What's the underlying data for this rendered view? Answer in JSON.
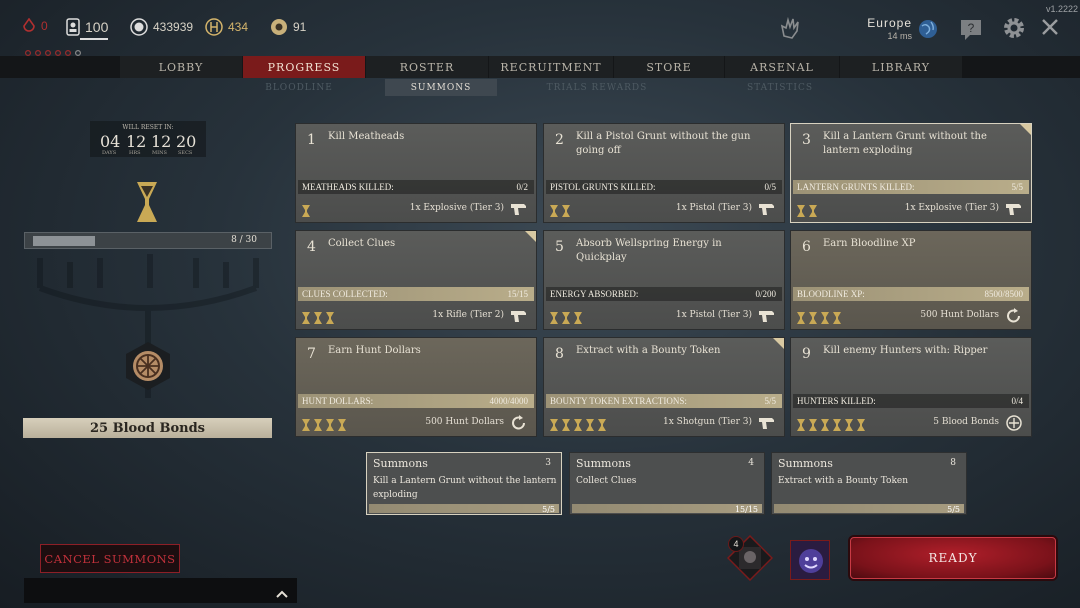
{
  "version": "v1.2222",
  "topbar": {
    "blood_value": "0",
    "hunters_value": "100",
    "hunt_dollars": "433939",
    "bloodline_value": "434",
    "event_points": "91",
    "region": "Europe",
    "ping": "14 ms"
  },
  "nav": {
    "tabs": [
      "LOBBY",
      "PROGRESS",
      "ROSTER",
      "RECRUITMENT",
      "STORE",
      "ARSENAL",
      "LIBRARY"
    ],
    "active": "PROGRESS"
  },
  "subnav": {
    "tabs": [
      "BLOODLINE",
      "SUMMONS",
      "TRIALS REWARDS",
      "STATISTICS"
    ],
    "active": "SUMMONS"
  },
  "reset": {
    "label": "WILL RESET IN:",
    "days": "04",
    "hrs": "12",
    "mins": "12",
    "secs": "20",
    "days_l": "DAYS",
    "hrs_l": "HRS",
    "mins_l": "MINS",
    "secs_l": "SECS"
  },
  "left": {
    "progress_text": "8 / 30",
    "progress_fraction": 0.27,
    "bonds_label": "25 Blood Bonds"
  },
  "cards": [
    {
      "num": "1",
      "title": "Kill Meatheads",
      "bar_label": "MEATHEADS KILLED:",
      "count": "0/2",
      "fraction": 0,
      "reward": "1x Explosive (Tier 3)",
      "icon": "revolver-icon",
      "tier": 1,
      "tan": false,
      "selected": false,
      "star": false
    },
    {
      "num": "2",
      "title": "Kill a Pistol Grunt without the gun going off",
      "bar_label": "PISTOL GRUNTS KILLED:",
      "count": "0/5",
      "fraction": 0,
      "reward": "1x Pistol (Tier 3)",
      "icon": "revolver-icon",
      "tier": 2,
      "tan": false,
      "selected": false,
      "star": false
    },
    {
      "num": "3",
      "title": "Kill a Lantern Grunt without the lantern exploding",
      "bar_label": "LANTERN GRUNTS KILLED:",
      "count": "5/5",
      "fraction": 1,
      "reward": "1x Explosive (Tier 3)",
      "icon": "revolver-icon",
      "tier": 2,
      "tan": false,
      "selected": true,
      "star": true
    },
    {
      "num": "4",
      "title": "Collect Clues",
      "bar_label": "CLUES COLLECTED:",
      "count": "15/15",
      "fraction": 1,
      "reward": "1x Rifle (Tier 2)",
      "icon": "revolver-icon",
      "tier": 3,
      "tan": false,
      "selected": false,
      "star": true
    },
    {
      "num": "5",
      "title": "Absorb Wellspring Energy in Quickplay",
      "bar_label": "ENERGY ABSORBED:",
      "count": "0/200",
      "fraction": 0,
      "reward": "1x Pistol (Tier 3)",
      "icon": "revolver-icon",
      "tier": 3,
      "tan": false,
      "selected": false,
      "star": false
    },
    {
      "num": "6",
      "title": "Earn Bloodline XP",
      "bar_label": "BLOODLINE XP:",
      "count": "8500/8500",
      "fraction": 1,
      "reward": "500 Hunt Dollars",
      "icon": "refresh-icon",
      "tier": 4,
      "tan": true,
      "selected": false,
      "star": false
    },
    {
      "num": "7",
      "title": "Earn Hunt Dollars",
      "bar_label": "HUNT DOLLARS:",
      "count": "4000/4000",
      "fraction": 1,
      "reward": "500 Hunt Dollars",
      "icon": "refresh-icon",
      "tier": 4,
      "tan": true,
      "selected": false,
      "star": false
    },
    {
      "num": "8",
      "title": "Extract with a Bounty Token",
      "bar_label": "BOUNTY TOKEN EXTRACTIONS:",
      "count": "5/5",
      "fraction": 1,
      "reward": "1x Shotgun (Tier 3)",
      "icon": "revolver-icon",
      "tier": 5,
      "tan": false,
      "selected": false,
      "star": true
    },
    {
      "num": "9",
      "title": "Kill enemy Hunters with: Ripper",
      "bar_label": "HUNTERS KILLED:",
      "count": "0/4",
      "fraction": 0,
      "reward": "5 Blood Bonds",
      "icon": "blood-bond-icon",
      "tier": 6,
      "tan": false,
      "selected": false,
      "star": false
    }
  ],
  "summons": [
    {
      "title": "Summons",
      "num": "3",
      "desc": "Kill a Lantern Grunt without the lantern exploding",
      "count": "5/5",
      "selected": true
    },
    {
      "title": "Summons",
      "num": "4",
      "desc": "Collect Clues",
      "count": "15/15",
      "selected": false
    },
    {
      "title": "Summons",
      "num": "8",
      "desc": "Extract with a Bounty Token",
      "count": "5/5",
      "selected": false
    }
  ],
  "bottom": {
    "cancel_label": "CANCEL SUMMONS",
    "ready_label": "READY",
    "badge_count": "4"
  },
  "colors": {
    "accent_red": "#7a1b1b",
    "gold": "#c9a955",
    "ready_red": "#8e1720"
  }
}
